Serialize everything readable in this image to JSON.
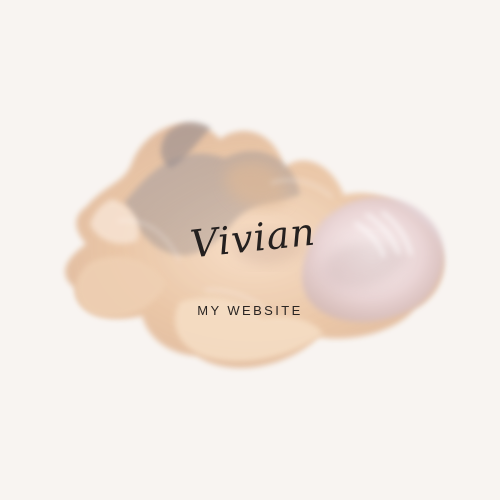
{
  "logo": {
    "script_name": "Vivian",
    "tagline": "MY WEBSITE"
  },
  "colors": {
    "background": "#f8f4f1",
    "splash_primary": "#e9c8a8",
    "splash_secondary": "#d7c5ba",
    "splash_grey": "#aaa0a2",
    "text": "#24201f"
  }
}
